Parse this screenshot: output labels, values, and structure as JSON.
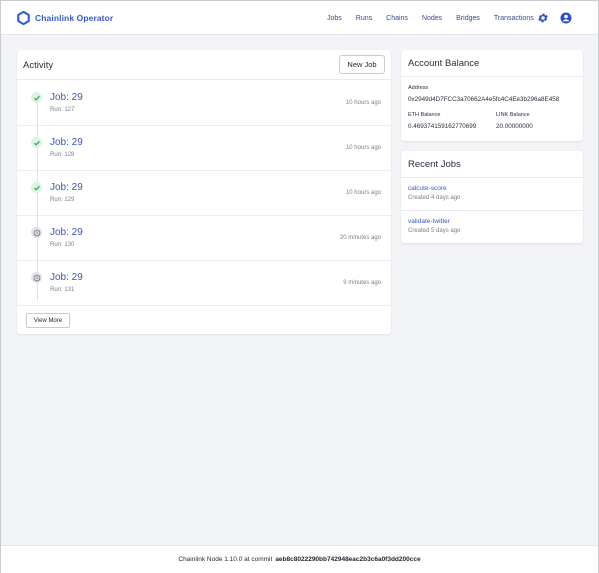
{
  "header": {
    "brand": "Chainlink Operator",
    "nav": [
      "Jobs",
      "Runs",
      "Chains",
      "Nodes",
      "Bridges",
      "Transactions"
    ],
    "icons": [
      "settings-icon",
      "account-icon"
    ],
    "accent_color": "#375bd2"
  },
  "activity": {
    "title": "Activity",
    "new_job_label": "New Job",
    "view_more_label": "View More",
    "runs": [
      {
        "job": "Job: 29",
        "run": "Run: 127",
        "time": "10 hours ago",
        "status": "completed"
      },
      {
        "job": "Job: 29",
        "run": "Run: 128",
        "time": "10 hours ago",
        "status": "completed"
      },
      {
        "job": "Job: 29",
        "run": "Run: 129",
        "time": "10 hours ago",
        "status": "completed"
      },
      {
        "job": "Job: 29",
        "run": "Run: 130",
        "time": "20 minutes ago",
        "status": "pending"
      },
      {
        "job": "Job: 29",
        "run": "Run: 131",
        "time": "9 minutes ago",
        "status": "pending"
      }
    ]
  },
  "balance": {
    "title": "Account Balance",
    "address_label": "Address",
    "address": "0x2949d4D7FCC3a70662A4e5fc4C4Ee3b296a8E458",
    "eth_label": "ETH Balance",
    "eth_value": "0.469374159162770699",
    "link_label": "LINK Balance",
    "link_value": "20.00000000"
  },
  "recent_jobs": {
    "title": "Recent Jobs",
    "items": [
      {
        "name": "calcute-score",
        "created": "Created 4 days ago"
      },
      {
        "name": "validate-twitter",
        "created": "Created 5 days ago"
      }
    ]
  },
  "footer": {
    "prefix": "Chainlink Node 1.10.0 at commit",
    "commit": "aeb8c8022290bb742948eac2b3c6a0f3dd200cce"
  }
}
